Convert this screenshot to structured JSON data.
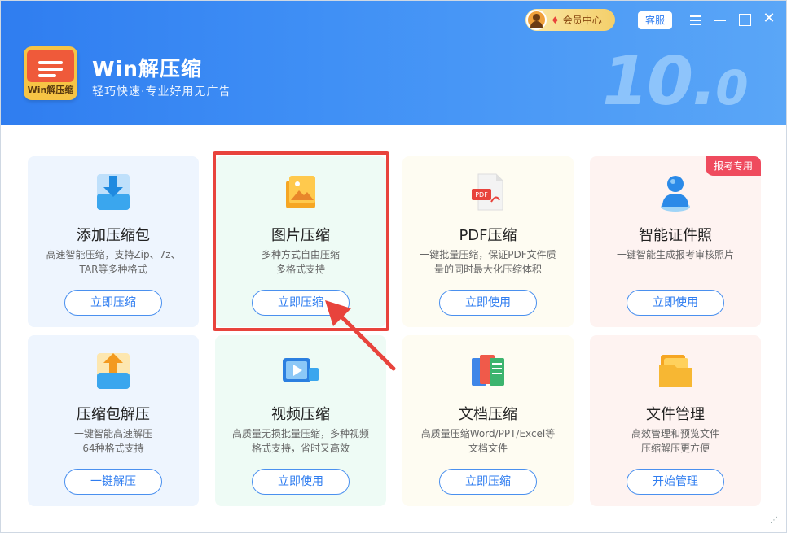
{
  "app": {
    "name": "Win解压缩",
    "slogan": "轻巧快速·专业好用无广告",
    "logo_text": "Win解压缩",
    "version_main": "10.",
    "version_sub": "0"
  },
  "header": {
    "vip_label": "会员中心",
    "service_label": "客服",
    "controls": [
      "menu-icon",
      "minimize-icon",
      "maximize-icon",
      "close-icon"
    ]
  },
  "cards": [
    {
      "title": "添加压缩包",
      "desc": [
        "高速智能压缩，支持Zip、7z、",
        "TAR等多种格式"
      ],
      "button": "立即压缩",
      "icon": "download-box-icon",
      "color": "blue"
    },
    {
      "title": "图片压缩",
      "desc": [
        "多种方式自由压缩",
        "多格式支持"
      ],
      "button": "立即压缩",
      "icon": "image-icon",
      "color": "green"
    },
    {
      "title": "PDF压缩",
      "desc": [
        "一键批量压缩，保证PDF文件质",
        "量的同时最大化压缩体积"
      ],
      "button": "立即使用",
      "icon": "pdf-icon",
      "color": "yellow"
    },
    {
      "title": "智能证件照",
      "desc": [
        "一键智能生成报考审核照片"
      ],
      "button": "立即使用",
      "icon": "person-icon",
      "color": "pink",
      "badge": "报考专用"
    },
    {
      "title": "压缩包解压",
      "desc": [
        "一键智能高速解压",
        "64种格式支持"
      ],
      "button": "一键解压",
      "icon": "upload-box-icon",
      "color": "blue"
    },
    {
      "title": "视频压缩",
      "desc": [
        "高质量无损批量压缩，多种视频",
        "格式支持，省时又高效"
      ],
      "button": "立即使用",
      "icon": "video-icon",
      "color": "green"
    },
    {
      "title": "文档压缩",
      "desc": [
        "高质量压缩Word/PPT/Excel等",
        "文档文件"
      ],
      "button": "立即压缩",
      "icon": "documents-icon",
      "color": "yellow"
    },
    {
      "title": "文件管理",
      "desc": [
        "高效管理和预览文件",
        "压缩解压更方便"
      ],
      "button": "开始管理",
      "icon": "folder-icon",
      "color": "pink"
    }
  ],
  "colors": {
    "header_start": "#2f7df0",
    "accent_blue": "#2f7df0",
    "highlight_red": "#e8433c",
    "badge_red": "#ef4b5e"
  }
}
